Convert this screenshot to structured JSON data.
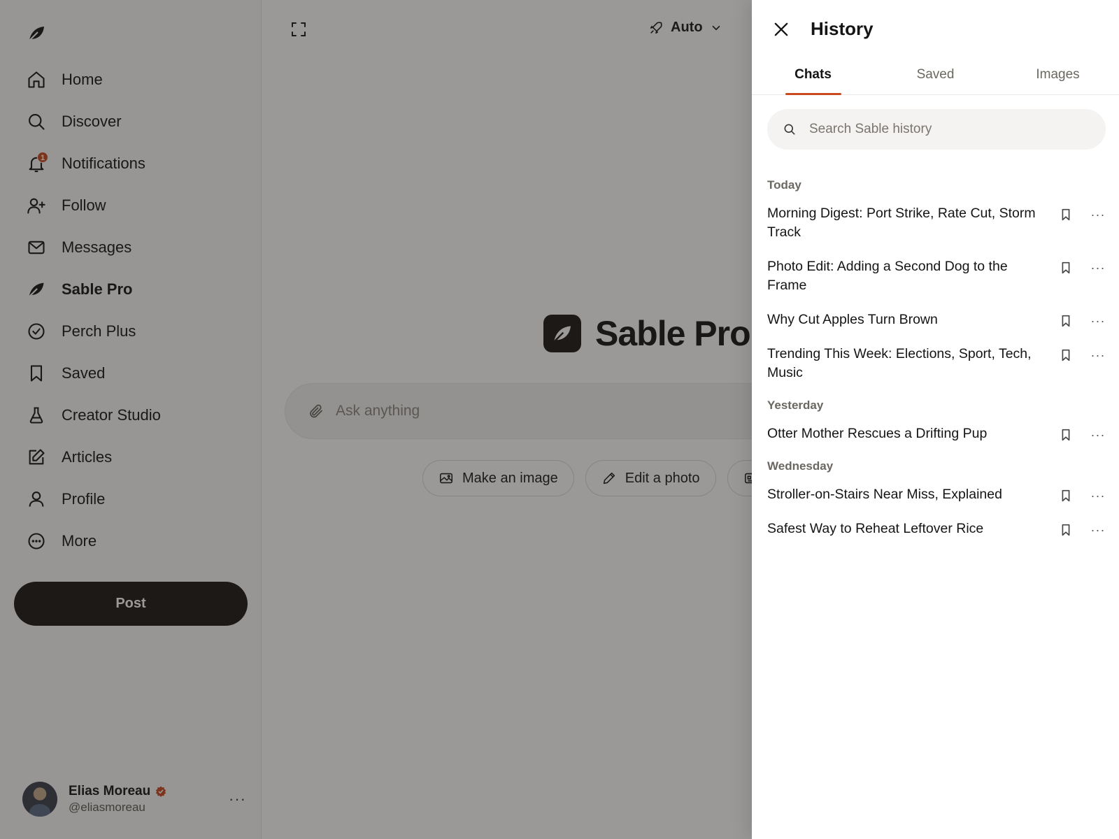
{
  "sidebar": {
    "items": [
      {
        "label": "Home",
        "icon": "home-icon"
      },
      {
        "label": "Discover",
        "icon": "search-icon"
      },
      {
        "label": "Notifications",
        "icon": "bell-icon",
        "badge": "1"
      },
      {
        "label": "Follow",
        "icon": "person-add-icon"
      },
      {
        "label": "Messages",
        "icon": "envelope-icon"
      },
      {
        "label": "Sable Pro",
        "icon": "leaf-icon",
        "active": true
      },
      {
        "label": "Perch Plus",
        "icon": "check-circle-icon"
      },
      {
        "label": "Saved",
        "icon": "bookmark-icon"
      },
      {
        "label": "Creator Studio",
        "icon": "flask-icon"
      },
      {
        "label": "Articles",
        "icon": "edit-square-icon"
      },
      {
        "label": "Profile",
        "icon": "person-icon"
      },
      {
        "label": "More",
        "icon": "more-circle-icon"
      }
    ],
    "post_label": "Post",
    "user": {
      "name": "Elias Moreau",
      "handle": "@eliasmoreau",
      "more": "···"
    }
  },
  "main": {
    "mode_label": "Auto",
    "brand": "Sable Pro",
    "ask_placeholder": "Ask anything",
    "chips": [
      {
        "label": "Make an image",
        "icon": "image-icon"
      },
      {
        "label": "Edit a photo",
        "icon": "pencil-icon"
      }
    ]
  },
  "panel": {
    "title": "History",
    "tabs": [
      "Chats",
      "Saved",
      "Images"
    ],
    "active_tab": "Chats",
    "search_placeholder": "Search Sable history",
    "groups": [
      {
        "label": "Today",
        "items": [
          "Morning Digest: Port Strike, Rate Cut, Storm Track",
          "Photo Edit: Adding a Second Dog to the Frame",
          "Why Cut Apples Turn Brown",
          "Trending This Week: Elections, Sport, Tech, Music"
        ]
      },
      {
        "label": "Yesterday",
        "items": [
          "Otter Mother Rescues a Drifting Pup"
        ]
      },
      {
        "label": "Wednesday",
        "items": [
          "Stroller-on-Stairs Near Miss, Explained",
          "Safest Way to Reheat Leftover Rice"
        ]
      }
    ]
  },
  "colors": {
    "accent": "#c84a1e",
    "dark": "#1a1714",
    "overlay": "rgba(30,28,26,0.45)"
  }
}
